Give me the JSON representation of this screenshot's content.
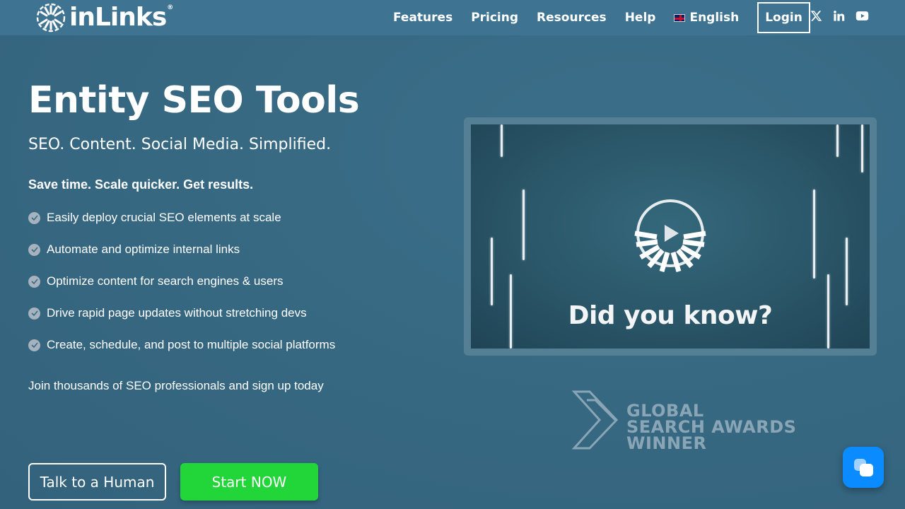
{
  "brand": {
    "name": "inLinks",
    "registered": "®"
  },
  "nav": {
    "items": [
      {
        "label": "Features"
      },
      {
        "label": "Pricing"
      },
      {
        "label": "Resources"
      },
      {
        "label": "Help"
      }
    ],
    "language": "English",
    "login": "Login"
  },
  "social": [
    "x-icon",
    "linkedin-icon",
    "youtube-icon"
  ],
  "hero": {
    "title": "Entity SEO Tools",
    "subtitle": "SEO. Content. Social Media. Simplified.",
    "tagline": "Save time. Scale quicker. Get results.",
    "features": [
      "Easily deploy crucial SEO elements at scale",
      "Automate and optimize internal links",
      "Optimize content for search engines & users",
      "Drive rapid page updates without stretching devs",
      "Create, schedule, and post to multiple social platforms"
    ],
    "join": "Join thousands of SEO professionals and sign up today",
    "cta_secondary": "Talk to a Human",
    "cta_primary": "Start NOW"
  },
  "video": {
    "caption": "Did you know?"
  },
  "award": {
    "line1": "GLOBAL",
    "line2": "SEARCH AWARDS",
    "line3": "WINNER"
  },
  "colors": {
    "background": "#386b85",
    "topbar": "#3e7492",
    "cta_primary": "#22d63a",
    "chat_button": "#0a8bff",
    "check_icon": "#a6b3be"
  }
}
